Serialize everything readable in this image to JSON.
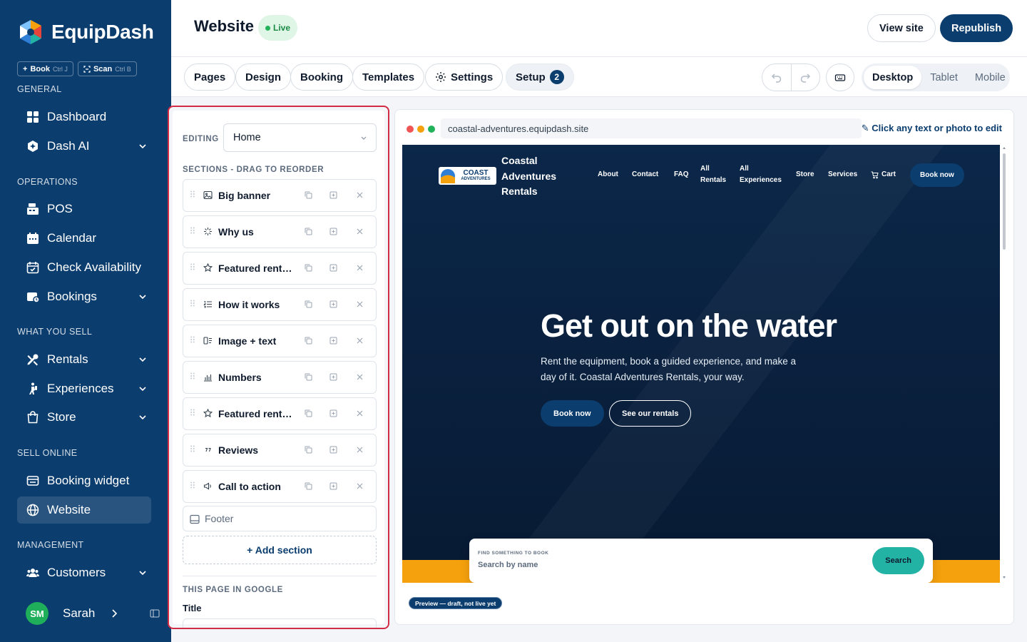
{
  "sidebar": {
    "brand": "EquipDash",
    "quick": [
      {
        "label": "Book",
        "shortcut": "Ctrl J"
      },
      {
        "label": "Scan",
        "shortcut": "Ctrl B"
      }
    ],
    "sections": {
      "general": "GENERAL",
      "operations": "OPERATIONS",
      "what_you_sell": "WHAT YOU SELL",
      "sell_online": "SELL ONLINE",
      "management": "MANAGEMENT"
    },
    "items": {
      "dashboard": "Dashboard",
      "dash_ai": "Dash AI",
      "pos": "POS",
      "calendar": "Calendar",
      "check_availability": "Check Availability",
      "bookings": "Bookings",
      "rentals": "Rentals",
      "experiences": "Experiences",
      "store": "Store",
      "booking_widget": "Booking widget",
      "website": "Website",
      "customers": "Customers"
    },
    "user": {
      "initials": "SM",
      "name": "Sarah"
    }
  },
  "header": {
    "title": "Website",
    "status": "Live",
    "view_site": "View site",
    "republish": "Republish"
  },
  "tabs": [
    "Pages",
    "Design",
    "Booking",
    "Templates",
    "Settings",
    "Setup"
  ],
  "setup_count": "2",
  "devices": [
    "Desktop",
    "Tablet",
    "Mobile"
  ],
  "active_device": "Desktop",
  "editor": {
    "editing_label": "EDITING",
    "page": "Home",
    "sections_label": "SECTIONS - DRAG TO REORDER",
    "sections": [
      {
        "name": "Big banner",
        "icon": "image-icon"
      },
      {
        "name": "Why us",
        "icon": "sparkle-icon"
      },
      {
        "name": "Featured rentals",
        "icon": "star-icon"
      },
      {
        "name": "How it works",
        "icon": "numbered-list-icon"
      },
      {
        "name": "Image + text",
        "icon": "image-text-icon"
      },
      {
        "name": "Numbers",
        "icon": "bar-chart-icon"
      },
      {
        "name": "Featured rentals",
        "icon": "star-icon"
      },
      {
        "name": "Reviews",
        "icon": "quote-icon"
      },
      {
        "name": "Call to action",
        "icon": "megaphone-icon"
      }
    ],
    "footer": "Footer",
    "add_section": "+ Add section",
    "google_label": "THIS PAGE IN GOOGLE",
    "title_label": "Title"
  },
  "preview": {
    "url": "coastal-adventures.equipdash.site",
    "hint": "✎ Click any text or photo to edit",
    "site": {
      "logo_text": "COAST",
      "logo_sub": "ADVENTURES",
      "name": "Coastal Adventures Rentals",
      "nav": [
        "About",
        "Contact",
        "FAQ",
        "All Rentals",
        "All Experiences",
        "Store",
        "Services",
        "Cart"
      ],
      "book_now": "Book now",
      "hero_title": "Get out on the water",
      "hero_sub": "Rent the equipment, book a guided experience, and make a day of it. Coastal Adventures Rentals, your way.",
      "btn_primary": "Book now",
      "btn_secondary": "See our rentals",
      "search_label": "FIND SOMETHING TO BOOK",
      "search_placeholder": "Search by name",
      "search_btn": "Search"
    },
    "draft_pill": "Preview — draft, not live yet"
  },
  "colors": {
    "sidebar": "#0b3d6e",
    "accent_live": "#22b35a",
    "highlight": "#d42c45",
    "teal": "#22b3a5",
    "orange": "#f5a10d"
  }
}
